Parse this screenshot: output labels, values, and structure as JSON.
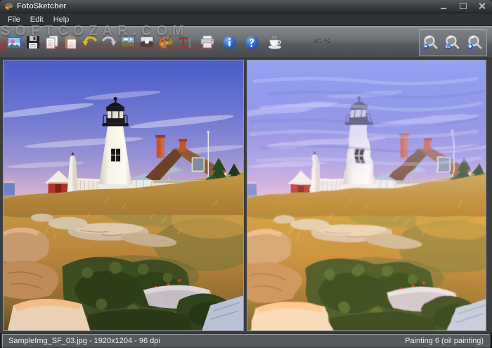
{
  "window": {
    "title": "FotoSketcher"
  },
  "menu": {
    "items": [
      "File",
      "Edit",
      "Help"
    ]
  },
  "toolbar": {
    "zoom_level": "45 %",
    "buttons": [
      "open-image",
      "save-image",
      "copy-image",
      "paste-image",
      "undo",
      "redo",
      "drawing-parameters",
      "modify-source-image",
      "painting-tools",
      "add-text",
      "print",
      "about",
      "help",
      "donate-coffee"
    ],
    "zoom_buttons": [
      "zoom-out",
      "zoom-one-to-one",
      "zoom-in"
    ]
  },
  "watermark": {
    "text": "SOFTCOZAR.COM"
  },
  "statusbar": {
    "file_info": "SampleImg_SF_03.jpg - 1920x1204 - 96 dpi",
    "effect_info": "Painting 6 (oil painting)"
  }
}
